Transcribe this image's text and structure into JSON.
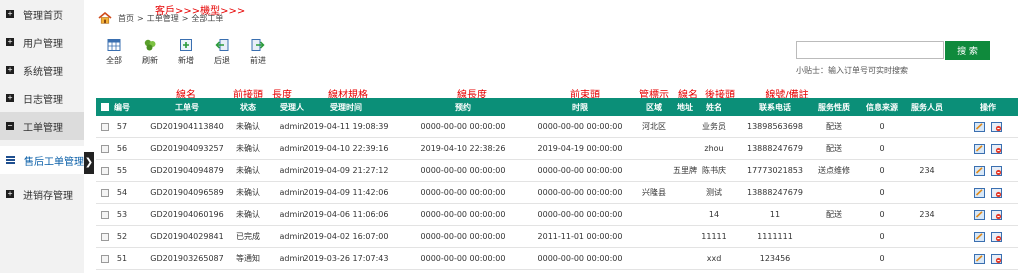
{
  "sidebar": {
    "items": [
      {
        "label": "管理首页",
        "marker": "+"
      },
      {
        "label": "用户管理",
        "marker": "+"
      },
      {
        "label": "系统管理",
        "marker": "+"
      },
      {
        "label": "日志管理",
        "marker": "+"
      },
      {
        "label": "工单管理",
        "marker": "−"
      },
      {
        "label": "售后工单管理",
        "marker": ""
      },
      {
        "label": "进销存管理",
        "marker": "+"
      }
    ],
    "collapse_glyph": "❯"
  },
  "annotation_top": "客戶>>>機型>>>",
  "breadcrumb": [
    "首页",
    "工单管理",
    "全部工单"
  ],
  "breadcrumb_sep": ">",
  "toolbar": [
    {
      "label": "全部",
      "icon": "grid-icon"
    },
    {
      "label": "刷新",
      "icon": "refresh-icon"
    },
    {
      "label": "新增",
      "icon": "add-icon"
    },
    {
      "label": "后退",
      "icon": "back-icon"
    },
    {
      "label": "前进",
      "icon": "forward-icon"
    }
  ],
  "search": {
    "placeholder": "",
    "button_label": "搜 索",
    "tip": "小贴士：输入订单号可实时搜索"
  },
  "annotations": [
    "線名",
    "前接頭",
    "長度",
    "線材規格",
    "線長度",
    "前束頭",
    "管標示",
    "線名",
    "後接頭",
    "線號/備註"
  ],
  "table": {
    "columns": [
      "编号",
      "工单号",
      "状态",
      "受理人",
      "受理时间",
      "预约",
      "时限",
      "区域",
      "地址",
      "姓名",
      "联系电话",
      "服务性质",
      "信息来源",
      "服务人员",
      "操作"
    ],
    "rows": [
      {
        "id": "57",
        "order": "GD201904113840",
        "status": "未确认",
        "agent": "admin",
        "time": "2019-04-11 19:08:39",
        "appt": "0000-00-00 00:00:00",
        "deadline": "0000-00-00 00:00:00",
        "region": "河北区",
        "address": "",
        "name": "业务员",
        "phone": "13898563698",
        "service": "配送",
        "source": "0",
        "staff": ""
      },
      {
        "id": "56",
        "order": "GD201904093257",
        "status": "未确认",
        "agent": "admin",
        "time": "2019-04-10 22:39:16",
        "appt": "2019-04-10 22:38:26",
        "deadline": "2019-04-19 00:00:00",
        "region": "",
        "address": "",
        "name": "zhou",
        "phone": "13888247679",
        "service": "配送",
        "source": "0",
        "staff": ""
      },
      {
        "id": "55",
        "order": "GD201904094879",
        "status": "未确认",
        "agent": "admin",
        "time": "2019-04-09 21:27:12",
        "appt": "0000-00-00 00:00:00",
        "deadline": "0000-00-00 00:00:00",
        "region": "",
        "address": "五里牌",
        "name": "陈书庆",
        "phone": "17773021853",
        "service": "送点维修",
        "source": "0",
        "staff": "234"
      },
      {
        "id": "54",
        "order": "GD201904096589",
        "status": "未确认",
        "agent": "admin",
        "time": "2019-04-09 11:42:06",
        "appt": "0000-00-00 00:00:00",
        "deadline": "0000-00-00 00:00:00",
        "region": "兴隆县",
        "address": "",
        "name": "测试",
        "phone": "13888247679",
        "service": "",
        "source": "0",
        "staff": ""
      },
      {
        "id": "53",
        "order": "GD201904060196",
        "status": "未确认",
        "agent": "admin",
        "time": "2019-04-06 11:06:06",
        "appt": "0000-00-00 00:00:00",
        "deadline": "0000-00-00 00:00:00",
        "region": "",
        "address": "",
        "name": "14",
        "phone": "11",
        "service": "配送",
        "source": "0",
        "staff": "234"
      },
      {
        "id": "52",
        "order": "GD201904029841",
        "status": "已完成",
        "agent": "admin",
        "time": "2019-04-02 16:07:00",
        "appt": "0000-00-00 00:00:00",
        "deadline": "2011-11-01 00:00:00",
        "region": "",
        "address": "",
        "name": "11111",
        "phone": "1111111",
        "service": "",
        "source": "0",
        "staff": ""
      },
      {
        "id": "51",
        "order": "GD201903265087",
        "status": "等通知",
        "agent": "admin",
        "time": "2019-03-26 17:07:43",
        "appt": "0000-00-00 00:00:00",
        "deadline": "0000-00-00 00:00:00",
        "region": "",
        "address": "",
        "name": "xxd",
        "phone": "123456",
        "service": "",
        "source": "0",
        "staff": ""
      }
    ]
  },
  "colors": {
    "header_bg": "#0b8f78",
    "search_button": "#0f8a3c",
    "annotation": "#e60000",
    "sub_item_text": "#0a5fa8"
  }
}
